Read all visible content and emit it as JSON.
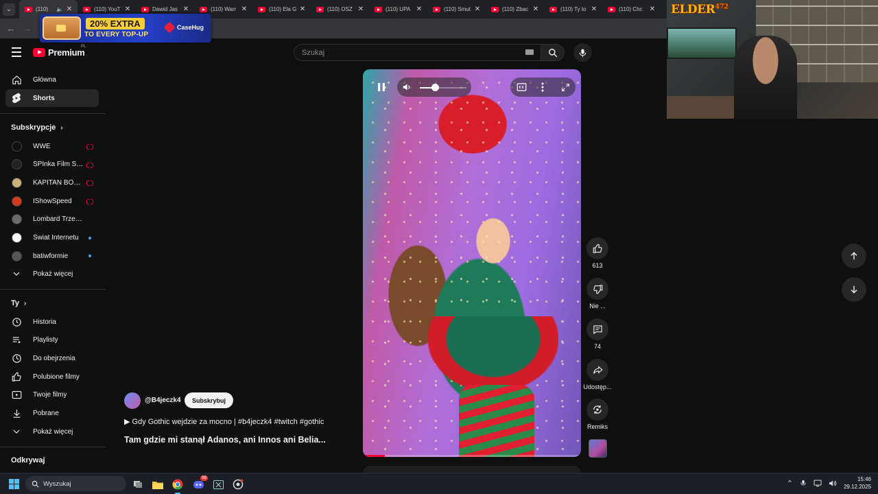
{
  "browser": {
    "tabs": [
      {
        "title": "(110) ",
        "active": true,
        "audio": true
      },
      {
        "title": "(110) YouT",
        "active": false
      },
      {
        "title": "Dawid Jas",
        "active": false
      },
      {
        "title": "(110) Warr",
        "active": false
      },
      {
        "title": "(110) Ela G",
        "active": false
      },
      {
        "title": "(110) OSZ",
        "active": false
      },
      {
        "title": "(110) UPA",
        "active": false
      },
      {
        "title": "(110) Smut",
        "active": false
      },
      {
        "title": "(110) Zbac",
        "active": false
      },
      {
        "title": "(110) Ty to",
        "active": false
      },
      {
        "title": "(110) Chc",
        "active": false
      }
    ]
  },
  "ad_banner": {
    "headline": "20% EXTRA",
    "subline": "TO EVERY TOP-UP",
    "brand": "CaseHug"
  },
  "webcam": {
    "logo": "ELDER",
    "logo_suffix": "472"
  },
  "header": {
    "logo_text": "Premium",
    "region": "PL",
    "search_placeholder": "Szukaj"
  },
  "sidebar": {
    "main": [
      {
        "label": "Główna",
        "icon": "home-icon"
      },
      {
        "label": "Shorts",
        "icon": "shorts-icon",
        "active": true
      }
    ],
    "subscriptions_heading": "Subskrypcje",
    "subscriptions": [
      {
        "label": "WWE",
        "status": "live"
      },
      {
        "label": "SPInka Film Studio",
        "status": "live"
      },
      {
        "label": "KAPITAN BOMBA",
        "status": "live"
      },
      {
        "label": "IShowSpeed",
        "status": "live"
      },
      {
        "label": "Lombard Trzebnica",
        "status": ""
      },
      {
        "label": "Świat Internetu",
        "status": "new"
      },
      {
        "label": "batiwformie",
        "status": "new"
      }
    ],
    "subs_more": "Pokaż więcej",
    "you_heading": "Ty",
    "you": [
      {
        "label": "Historia",
        "icon": "history-icon"
      },
      {
        "label": "Playlisty",
        "icon": "playlists-icon"
      },
      {
        "label": "Do obejrzenia",
        "icon": "watch-later-icon"
      },
      {
        "label": "Polubione filmy",
        "icon": "liked-icon"
      },
      {
        "label": "Twoje filmy",
        "icon": "your-videos-icon"
      },
      {
        "label": "Pobrane",
        "icon": "download-icon"
      }
    ],
    "you_more": "Pokaż więcej",
    "explore_heading": "Odkrywaj"
  },
  "player": {
    "volume_level": 0.33,
    "progress": 0.1
  },
  "actions": {
    "likes": "613",
    "dislike_label": "Nie ...",
    "comments": "74",
    "share_label": "Udostęp...",
    "remix_label": "Remiks"
  },
  "video": {
    "channel": "@B4jeczk4",
    "subscribe_label": "Subskrybuj",
    "music_line": "▶ Gdy Gothic wejdzie za mocno | #b4jeczk4 #twitch #gothic",
    "title": "Tam gdzie mi stanął Adanos, ani Innos ani Belia..."
  },
  "taskbar": {
    "search_placeholder": "Wyszukaj",
    "discord_badge": "99",
    "time": "15:46",
    "date": "29.12.2025"
  }
}
